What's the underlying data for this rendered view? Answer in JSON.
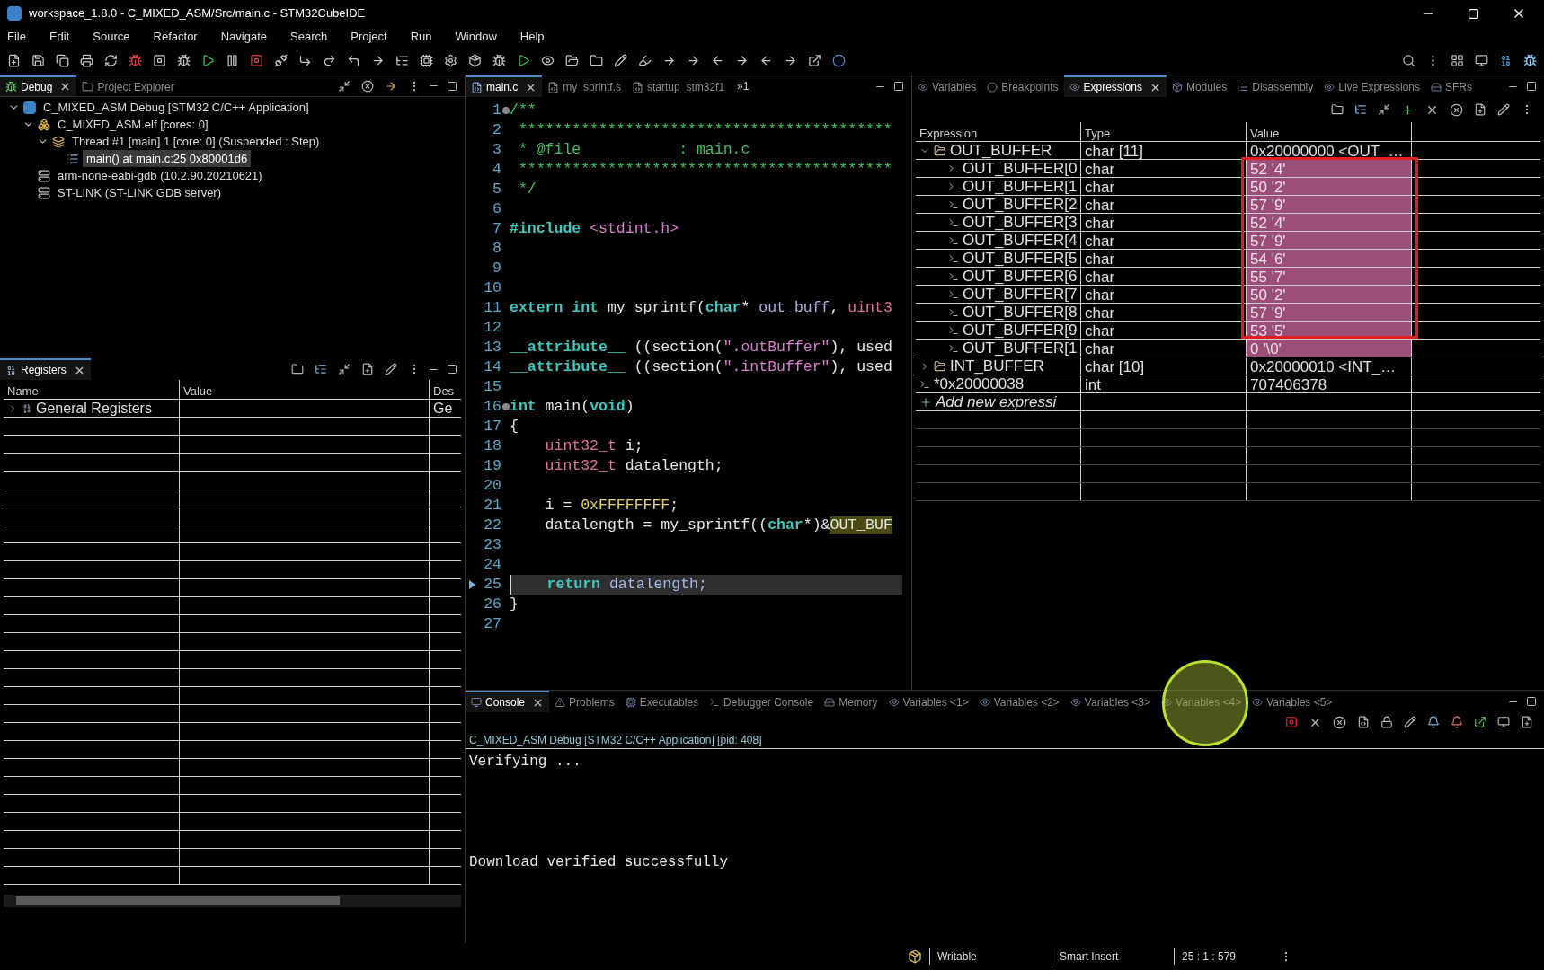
{
  "window": {
    "title": "workspace_1.8.0 - C_MIXED_ASM/Src/main.c - STM32CubeIDE"
  },
  "menu": [
    "File",
    "Edit",
    "Source",
    "Refactor",
    "Navigate",
    "Search",
    "Project",
    "Run",
    "Window",
    "Help"
  ],
  "debug_panel": {
    "tabs": [
      {
        "label": "Debug",
        "selected": true
      },
      {
        "label": "Project Explorer",
        "selected": false
      }
    ],
    "tree": [
      {
        "label": "C_MIXED_ASM Debug [STM32 C/C++ Application]",
        "kind": "launch",
        "expanded": true,
        "selected": false,
        "children": [
          {
            "label": "C_MIXED_ASM.elf [cores: 0]",
            "kind": "process",
            "expanded": true,
            "selected": false,
            "children": [
              {
                "label": "Thread #1 [main] 1 [core: 0] (Suspended : Step)",
                "kind": "thread",
                "expanded": true,
                "selected": false,
                "children": [
                  {
                    "label": "main() at main.c:25 0x80001d6",
                    "kind": "frame",
                    "selected": true
                  }
                ]
              }
            ]
          },
          {
            "label": "arm-none-eabi-gdb (10.2.90.20210621)",
            "kind": "server",
            "selected": false
          },
          {
            "label": "ST-LINK (ST-LINK GDB server)",
            "kind": "server",
            "selected": false
          }
        ]
      }
    ]
  },
  "registers_panel": {
    "tabs": [
      {
        "label": "Registers",
        "selected": true
      }
    ],
    "columns": [
      "Name",
      "Value",
      "Des"
    ],
    "rows": [
      {
        "name": "General Registers",
        "description": "Ge",
        "expanded": false
      }
    ]
  },
  "editor": {
    "tabs": [
      {
        "label": "main.c",
        "kind": "c",
        "selected": true
      },
      {
        "label": "my_sprintf.s",
        "kind": "asm",
        "selected": false
      },
      {
        "label": "startup_stm32f1",
        "kind": "asm",
        "selected": false
      }
    ],
    "overflow": "»1",
    "lines": [
      {
        "number": "1",
        "foldable": true,
        "current": false,
        "tokens": [
          {
            "text": "/**",
            "kind": "comment"
          }
        ]
      },
      {
        "number": "2",
        "foldable": false,
        "current": false,
        "tokens": [
          {
            "text": " ******************************************",
            "kind": "comment"
          }
        ]
      },
      {
        "number": "3",
        "foldable": false,
        "current": false,
        "tokens": [
          {
            "text": " * @file           : main.c",
            "kind": "comment"
          }
        ]
      },
      {
        "number": "4",
        "foldable": false,
        "current": false,
        "tokens": [
          {
            "text": " ******************************************",
            "kind": "comment"
          }
        ]
      },
      {
        "number": "5",
        "foldable": false,
        "current": false,
        "tokens": [
          {
            "text": " */",
            "kind": "comment"
          }
        ]
      },
      {
        "number": "6",
        "foldable": false,
        "current": false
      },
      {
        "number": "7",
        "foldable": false,
        "current": false,
        "tokens": [
          {
            "text": "#include",
            "kind": "keyword"
          },
          {
            "text": " <stdint.h>",
            "kind": "string"
          }
        ]
      },
      {
        "number": "8",
        "foldable": false,
        "current": false
      },
      {
        "number": "9",
        "foldable": false,
        "current": false
      },
      {
        "number": "10",
        "foldable": false,
        "current": false
      },
      {
        "number": "11",
        "foldable": false,
        "current": false,
        "tokens": [
          {
            "text": "extern int",
            "kind": "keyword"
          },
          {
            "text": " my_sprintf(",
            "kind": "plain"
          },
          {
            "text": "char",
            "kind": "keyword"
          },
          {
            "text": "* ",
            "kind": "plain"
          },
          {
            "text": "out_buff",
            "kind": "variable"
          },
          {
            "text": ", ",
            "kind": "plain"
          },
          {
            "text": "uint3",
            "kind": "type"
          }
        ]
      },
      {
        "number": "12",
        "foldable": false,
        "current": false
      },
      {
        "number": "13",
        "foldable": false,
        "current": false,
        "tokens": [
          {
            "text": "__attribute__",
            "kind": "keyword"
          },
          {
            "text": " ((section(",
            "kind": "plain"
          },
          {
            "text": "\".outBuffer\"",
            "kind": "string"
          },
          {
            "text": "), used",
            "kind": "plain"
          }
        ]
      },
      {
        "number": "14",
        "foldable": false,
        "current": false,
        "tokens": [
          {
            "text": "__attribute__",
            "kind": "keyword"
          },
          {
            "text": " ((section(",
            "kind": "plain"
          },
          {
            "text": "\".intBuffer\"",
            "kind": "string"
          },
          {
            "text": "), used",
            "kind": "plain"
          }
        ]
      },
      {
        "number": "15",
        "foldable": false,
        "current": false
      },
      {
        "number": "16",
        "foldable": true,
        "current": false,
        "tokens": [
          {
            "text": "int",
            "kind": "keyword"
          },
          {
            "text": " main(",
            "kind": "plain"
          },
          {
            "text": "void",
            "kind": "keyword"
          },
          {
            "text": ")",
            "kind": "plain"
          }
        ]
      },
      {
        "number": "17",
        "foldable": false,
        "current": false,
        "tokens": [
          {
            "text": "{",
            "kind": "plain"
          }
        ]
      },
      {
        "number": "18",
        "foldable": false,
        "current": false,
        "tokens": [
          {
            "text": "    uint32_t",
            "kind": "type"
          },
          {
            "text": " i;",
            "kind": "plain"
          }
        ]
      },
      {
        "number": "19",
        "foldable": false,
        "current": false,
        "tokens": [
          {
            "text": "    uint32_t",
            "kind": "type"
          },
          {
            "text": " datalength;",
            "kind": "plain"
          }
        ]
      },
      {
        "number": "20",
        "foldable": false,
        "current": false
      },
      {
        "number": "21",
        "foldable": false,
        "current": false,
        "tokens": [
          {
            "text": "    i = ",
            "kind": "plain"
          },
          {
            "text": "0xFFFFFFFF",
            "kind": "number"
          },
          {
            "text": ";",
            "kind": "plain"
          }
        ]
      },
      {
        "number": "22",
        "foldable": false,
        "current": false,
        "tokens": [
          {
            "text": "    datalength = my_sprintf((",
            "kind": "plain"
          },
          {
            "text": "char",
            "kind": "keyword"
          },
          {
            "text": "*)&",
            "kind": "plain"
          },
          {
            "text": "OUT_BUF",
            "kind": "occurrence"
          }
        ]
      },
      {
        "number": "23",
        "foldable": false,
        "current": false
      },
      {
        "number": "24",
        "foldable": false,
        "current": false
      },
      {
        "number": "25",
        "foldable": false,
        "current": true,
        "tokens": [
          {
            "text": "    return",
            "kind": "keyword"
          },
          {
            "text": " datalength;",
            "kind": "variable"
          }
        ]
      },
      {
        "number": "26",
        "foldable": false,
        "current": false,
        "tokens": [
          {
            "text": "}",
            "kind": "plain"
          }
        ]
      },
      {
        "number": "27",
        "foldable": false,
        "current": false
      }
    ]
  },
  "expressions_panel": {
    "tabs": [
      {
        "label": "Variables",
        "selected": false
      },
      {
        "label": "Breakpoints",
        "selected": false
      },
      {
        "label": "Expressions",
        "selected": true
      },
      {
        "label": "Modules",
        "selected": false
      },
      {
        "label": "Disassembly",
        "selected": false
      },
      {
        "label": "Live Expressions",
        "selected": false
      },
      {
        "label": "SFRs",
        "selected": false
      }
    ],
    "columns": [
      "Expression",
      "Type",
      "Value"
    ],
    "rows": [
      {
        "expression": "OUT_BUFFER",
        "type": "char [11]",
        "value": "0x20000000 <OUT_…",
        "kind": "group",
        "expanded": true,
        "changed": false
      },
      {
        "expression": "OUT_BUFFER[0",
        "type": "char",
        "value": "52 '4'",
        "kind": "element",
        "changed": true
      },
      {
        "expression": "OUT_BUFFER[1",
        "type": "char",
        "value": "50 '2'",
        "kind": "element",
        "changed": true
      },
      {
        "expression": "OUT_BUFFER[2",
        "type": "char",
        "value": "57 '9'",
        "kind": "element",
        "changed": true
      },
      {
        "expression": "OUT_BUFFER[3",
        "type": "char",
        "value": "52 '4'",
        "kind": "element",
        "changed": true
      },
      {
        "expression": "OUT_BUFFER[4",
        "type": "char",
        "value": "57 '9'",
        "kind": "element",
        "changed": true
      },
      {
        "expression": "OUT_BUFFER[5",
        "type": "char",
        "value": "54 '6'",
        "kind": "element",
        "changed": true
      },
      {
        "expression": "OUT_BUFFER[6",
        "type": "char",
        "value": "55 '7'",
        "kind": "element",
        "changed": true
      },
      {
        "expression": "OUT_BUFFER[7",
        "type": "char",
        "value": "50 '2'",
        "kind": "element",
        "changed": true
      },
      {
        "expression": "OUT_BUFFER[8",
        "type": "char",
        "value": "57 '9'",
        "kind": "element",
        "changed": true
      },
      {
        "expression": "OUT_BUFFER[9",
        "type": "char",
        "value": "53 '5'",
        "kind": "element",
        "changed": true
      },
      {
        "expression": "OUT_BUFFER[1",
        "type": "char",
        "value": "0 '\\0'",
        "kind": "element",
        "changed": true
      },
      {
        "expression": "INT_BUFFER",
        "type": "char [10]",
        "value": "0x20000010 <INT_…",
        "kind": "group",
        "expanded": false,
        "changed": false
      },
      {
        "expression": "*0x20000038",
        "type": "int",
        "value": "707406378",
        "kind": "element",
        "changed": false
      },
      {
        "expression": "Add new expressi",
        "kind": "add",
        "changed": false
      }
    ]
  },
  "console_panel": {
    "tabs": [
      {
        "label": "Console",
        "selected": true
      },
      {
        "label": "Problems",
        "selected": false
      },
      {
        "label": "Executables",
        "selected": false
      },
      {
        "label": "Debugger Console",
        "selected": false
      },
      {
        "label": "Memory",
        "selected": false
      },
      {
        "label": "Variables <1>",
        "selected": false
      },
      {
        "label": "Variables <2>",
        "selected": false
      },
      {
        "label": "Variables <3>",
        "selected": false
      },
      {
        "label": "Variables <4>",
        "selected": false
      },
      {
        "label": "Variables <5>",
        "selected": false
      }
    ],
    "header": "C_MIXED_ASM Debug [STM32 C/C++ Application]  [pid: 408]",
    "output": [
      "Verifying ...",
      "Download verified successfully"
    ]
  },
  "status_bar": {
    "mode": "Writable",
    "insert": "Smart Insert",
    "position": "25 : 1 : 579"
  }
}
